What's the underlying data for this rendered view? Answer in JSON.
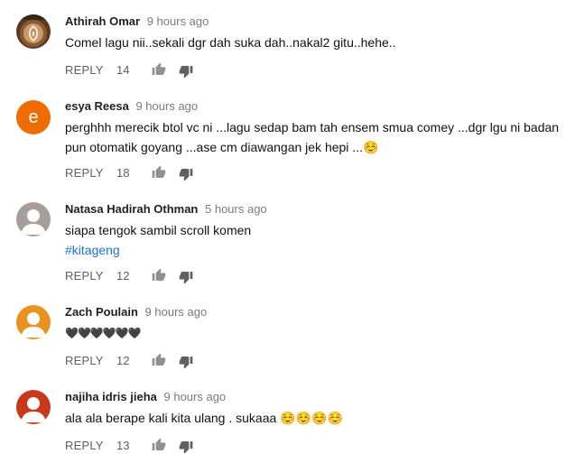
{
  "comments": [
    {
      "author": "Athirah Omar",
      "time": "9 hours ago",
      "text": "Comel lagu nii..sekali dgr dah suka dah..nakal2 gitu..hehe..",
      "likes": "14",
      "reply_label": "REPLY",
      "avatar_icon": "latte-art-photo"
    },
    {
      "author": "esya Reesa",
      "time": "9 hours ago",
      "text": "perghhh merecik btol vc ni ...lagu sedap bam tah ensem smua comey ...dgr lgu ni badan pun otomatik goyang ...ase cm diawangan jek hepi ...☺️",
      "likes": "18",
      "reply_label": "REPLY",
      "avatar_letter": "e",
      "avatar_color": "#ef6c00"
    },
    {
      "author": "Natasa Hadirah Othman",
      "time": "5 hours ago",
      "text": "siapa tengok sambil scroll komen",
      "hashtag": "#kitageng",
      "likes": "12",
      "reply_label": "REPLY",
      "avatar_icon": "default-person-icon",
      "avatar_color": "#a89e99"
    },
    {
      "author": "Zach Poulain",
      "time": "9 hours ago",
      "text": "🖤🖤🖤🖤🖤🖤",
      "likes": "12",
      "reply_label": "REPLY",
      "avatar_icon": "default-person-icon",
      "avatar_color": "#e8921f"
    },
    {
      "author": "najiha idris jieha",
      "time": "9 hours ago",
      "text": "ala ala berape kali kita ulang . sukaaa ☺️☺️☺️☺️",
      "likes": "13",
      "reply_label": "REPLY",
      "avatar_icon": "default-person-icon",
      "avatar_color": "#c8381a"
    }
  ],
  "colors": {
    "author": "#1f1f1f",
    "meta": "#606060",
    "hashtag": "#1a73c8"
  }
}
